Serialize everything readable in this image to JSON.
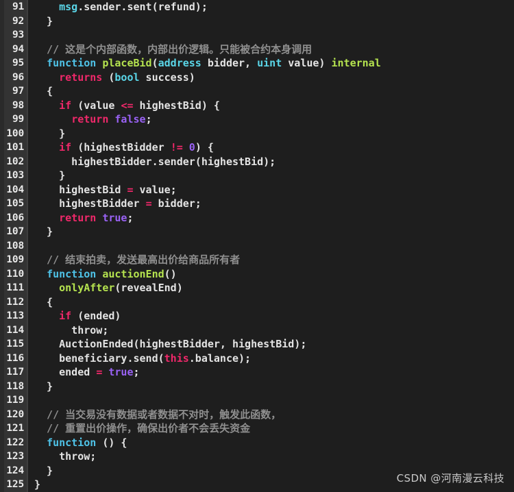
{
  "editor": {
    "theme": "dark",
    "language": "Solidity",
    "background_color": "#1e1e1e",
    "gutter_color": "#333333",
    "first_line": 91,
    "last_line": 125,
    "colors": {
      "keyword": "#4fc3e8",
      "type": "#5ad6e8",
      "function_name": "#b5e34f",
      "control": "#f0286a",
      "constant": "#9a62f5",
      "comment": "#8f8f8f",
      "plain_text": "#e4e4e4",
      "line_number": "#e8e8e8"
    }
  },
  "lines": [
    {
      "number": "91",
      "tokens": [
        {
          "t": "    ",
          "c": "plain"
        },
        {
          "t": "msg",
          "c": "type"
        },
        {
          "t": ".sender.sent(refund);",
          "c": "plain"
        }
      ]
    },
    {
      "number": "92",
      "tokens": [
        {
          "t": "  }",
          "c": "plain"
        }
      ]
    },
    {
      "number": "93",
      "tokens": [
        {
          "t": "",
          "c": "plain"
        }
      ]
    },
    {
      "number": "94",
      "tokens": [
        {
          "t": "  // 这是个内部函数，内部出价逻辑。只能被合约本身调用",
          "c": "comment"
        }
      ]
    },
    {
      "number": "95",
      "tokens": [
        {
          "t": "  ",
          "c": "plain"
        },
        {
          "t": "function",
          "c": "keyword"
        },
        {
          "t": " ",
          "c": "plain"
        },
        {
          "t": "placeBid",
          "c": "function_name"
        },
        {
          "t": "(",
          "c": "plain"
        },
        {
          "t": "address",
          "c": "type"
        },
        {
          "t": " bidder, ",
          "c": "plain"
        },
        {
          "t": "uint",
          "c": "type"
        },
        {
          "t": " value) ",
          "c": "plain"
        },
        {
          "t": "internal",
          "c": "function_name"
        }
      ]
    },
    {
      "number": "96",
      "tokens": [
        {
          "t": "    ",
          "c": "plain"
        },
        {
          "t": "returns",
          "c": "control"
        },
        {
          "t": " (",
          "c": "plain"
        },
        {
          "t": "bool",
          "c": "type"
        },
        {
          "t": " success)",
          "c": "plain"
        }
      ]
    },
    {
      "number": "97",
      "tokens": [
        {
          "t": "  {",
          "c": "plain"
        }
      ]
    },
    {
      "number": "98",
      "tokens": [
        {
          "t": "    ",
          "c": "plain"
        },
        {
          "t": "if",
          "c": "control"
        },
        {
          "t": " (value ",
          "c": "plain"
        },
        {
          "t": "<=",
          "c": "control"
        },
        {
          "t": " highestBid) {",
          "c": "plain"
        }
      ]
    },
    {
      "number": "99",
      "tokens": [
        {
          "t": "      ",
          "c": "plain"
        },
        {
          "t": "return",
          "c": "control"
        },
        {
          "t": " ",
          "c": "plain"
        },
        {
          "t": "false",
          "c": "constant"
        },
        {
          "t": ";",
          "c": "plain"
        }
      ]
    },
    {
      "number": "100",
      "tokens": [
        {
          "t": "    }",
          "c": "plain"
        }
      ]
    },
    {
      "number": "101",
      "tokens": [
        {
          "t": "    ",
          "c": "plain"
        },
        {
          "t": "if",
          "c": "control"
        },
        {
          "t": " (highestBidder ",
          "c": "plain"
        },
        {
          "t": "!=",
          "c": "control"
        },
        {
          "t": " ",
          "c": "plain"
        },
        {
          "t": "0",
          "c": "constant"
        },
        {
          "t": ") {",
          "c": "plain"
        }
      ]
    },
    {
      "number": "102",
      "tokens": [
        {
          "t": "      highestBidder.sender(highestBid);",
          "c": "plain"
        }
      ]
    },
    {
      "number": "103",
      "tokens": [
        {
          "t": "    }",
          "c": "plain"
        }
      ]
    },
    {
      "number": "104",
      "tokens": [
        {
          "t": "    highestBid ",
          "c": "plain"
        },
        {
          "t": "=",
          "c": "control"
        },
        {
          "t": " value;",
          "c": "plain"
        }
      ]
    },
    {
      "number": "105",
      "tokens": [
        {
          "t": "    highestBidder ",
          "c": "plain"
        },
        {
          "t": "=",
          "c": "control"
        },
        {
          "t": " bidder;",
          "c": "plain"
        }
      ]
    },
    {
      "number": "106",
      "tokens": [
        {
          "t": "    ",
          "c": "plain"
        },
        {
          "t": "return",
          "c": "control"
        },
        {
          "t": " ",
          "c": "plain"
        },
        {
          "t": "true",
          "c": "constant"
        },
        {
          "t": ";",
          "c": "plain"
        }
      ]
    },
    {
      "number": "107",
      "tokens": [
        {
          "t": "  }",
          "c": "plain"
        }
      ]
    },
    {
      "number": "108",
      "tokens": [
        {
          "t": "",
          "c": "plain"
        }
      ]
    },
    {
      "number": "109",
      "tokens": [
        {
          "t": "  // 结束拍卖，发送最高出价给商品所有者",
          "c": "comment"
        }
      ]
    },
    {
      "number": "110",
      "tokens": [
        {
          "t": "  ",
          "c": "plain"
        },
        {
          "t": "function",
          "c": "keyword"
        },
        {
          "t": " ",
          "c": "plain"
        },
        {
          "t": "auctionEnd",
          "c": "function_name"
        },
        {
          "t": "()",
          "c": "plain"
        }
      ]
    },
    {
      "number": "111",
      "tokens": [
        {
          "t": "    ",
          "c": "plain"
        },
        {
          "t": "onlyAfter",
          "c": "function_name"
        },
        {
          "t": "(revealEnd)",
          "c": "plain"
        }
      ]
    },
    {
      "number": "112",
      "tokens": [
        {
          "t": "  {",
          "c": "plain"
        }
      ]
    },
    {
      "number": "113",
      "tokens": [
        {
          "t": "    ",
          "c": "plain"
        },
        {
          "t": "if",
          "c": "control"
        },
        {
          "t": " (ended)",
          "c": "plain"
        }
      ]
    },
    {
      "number": "114",
      "tokens": [
        {
          "t": "      throw;",
          "c": "plain"
        }
      ]
    },
    {
      "number": "115",
      "tokens": [
        {
          "t": "    AuctionEnded(highestBidder, highestBid);",
          "c": "plain"
        }
      ]
    },
    {
      "number": "116",
      "tokens": [
        {
          "t": "    beneficiary.send(",
          "c": "plain"
        },
        {
          "t": "this",
          "c": "control"
        },
        {
          "t": ".balance);",
          "c": "plain"
        }
      ]
    },
    {
      "number": "117",
      "tokens": [
        {
          "t": "    ended ",
          "c": "plain"
        },
        {
          "t": "=",
          "c": "control"
        },
        {
          "t": " ",
          "c": "plain"
        },
        {
          "t": "true",
          "c": "constant"
        },
        {
          "t": ";",
          "c": "plain"
        }
      ]
    },
    {
      "number": "118",
      "tokens": [
        {
          "t": "  }",
          "c": "plain"
        }
      ]
    },
    {
      "number": "119",
      "tokens": [
        {
          "t": "",
          "c": "plain"
        }
      ]
    },
    {
      "number": "120",
      "tokens": [
        {
          "t": "  // 当交易没有数据或者数据不对时，触发此函数，",
          "c": "comment"
        }
      ]
    },
    {
      "number": "121",
      "tokens": [
        {
          "t": "  // 重置出价操作，确保出价者不会丢失资金",
          "c": "comment"
        }
      ]
    },
    {
      "number": "122",
      "tokens": [
        {
          "t": "  ",
          "c": "plain"
        },
        {
          "t": "function",
          "c": "keyword"
        },
        {
          "t": " () {",
          "c": "plain"
        }
      ]
    },
    {
      "number": "123",
      "tokens": [
        {
          "t": "    throw;",
          "c": "plain"
        }
      ]
    },
    {
      "number": "124",
      "tokens": [
        {
          "t": "  }",
          "c": "plain"
        }
      ]
    },
    {
      "number": "125",
      "tokens": [
        {
          "t": "}",
          "c": "plain"
        }
      ]
    }
  ],
  "watermark": {
    "text": "CSDN @河南漫云科技"
  }
}
